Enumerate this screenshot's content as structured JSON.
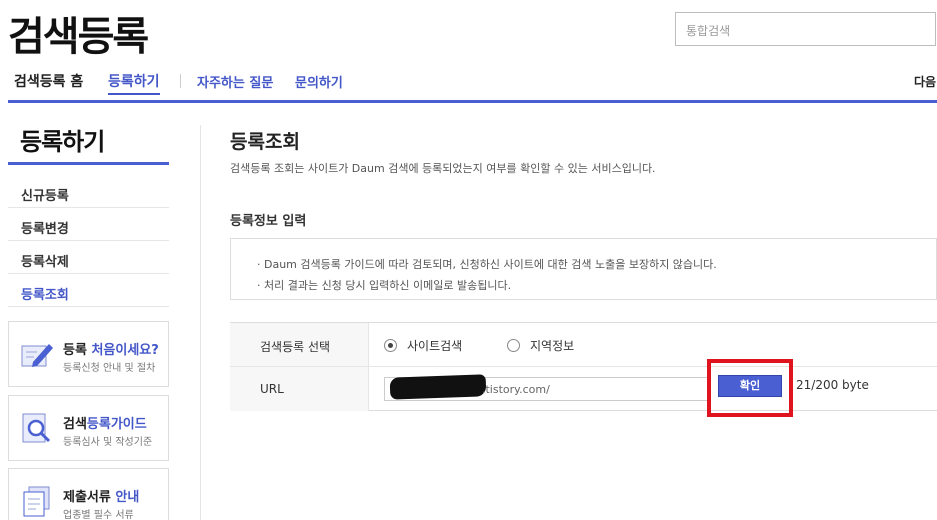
{
  "header": {
    "logo": "검색등록",
    "search_placeholder": "통합검색"
  },
  "gnb": {
    "items": [
      "검색등록 홈",
      "등록하기",
      "자주하는 질문",
      "문의하기"
    ],
    "right": "다음"
  },
  "sidebar": {
    "title": "등록하기",
    "items": [
      {
        "label": "신규등록",
        "active": false
      },
      {
        "label": "등록변경",
        "active": false
      },
      {
        "label": "등록삭제",
        "active": false
      },
      {
        "label": "등록조회",
        "active": true
      }
    ],
    "banners": [
      {
        "title_a": "등록 ",
        "title_b": "처음이세요?",
        "desc": "등록신청 안내 및 절차",
        "icon": "pencil-form-icon"
      },
      {
        "title_a": "검색",
        "title_b": "등록가이드",
        "desc": "등록심사 및 작성기준",
        "icon": "magnifier-doc-icon"
      },
      {
        "title_a": "제출서류 ",
        "title_b": "안내",
        "desc": "업종별 필수 서류",
        "icon": "documents-icon"
      }
    ]
  },
  "content": {
    "title": "등록조회",
    "description": "검색등록 조회는 사이트가 Daum 검색에 등록되었는지 여부를 확인할 수 있는 서비스입니다.",
    "section_title": "등록정보 입력",
    "notices": [
      "· Daum 검색등록 가이드에 따라 검토되며, 신청하신 사이트에 대한 검색 노출을 보장하지 않습니다.",
      "· 처리 결과는 신청 당시 입력하신 이메일로 발송됩니다."
    ],
    "form": {
      "type_label": "검색등록 선택",
      "options": [
        {
          "label": "사이트검색",
          "selected": true
        },
        {
          "label": "지역정보",
          "selected": false
        }
      ],
      "url_label": "URL",
      "url_value_visible": ".tistory.com/",
      "confirm_label": "확인",
      "byte_count": "21/200 byte"
    }
  },
  "colors": {
    "accent": "#4a5fd1",
    "highlight_box": "#e0141e"
  }
}
